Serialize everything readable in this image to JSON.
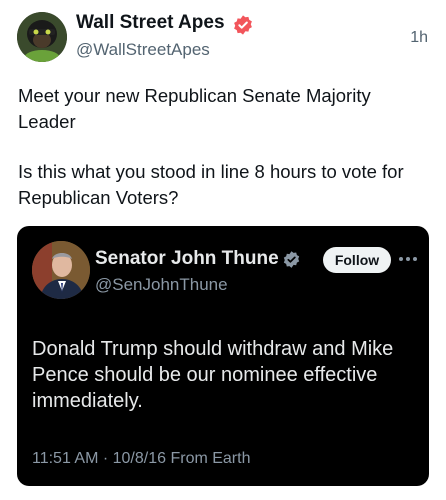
{
  "author": {
    "name": "Wall Street Apes",
    "handle": "@WallStreetApes",
    "verified": true,
    "avatar_icon": "gorilla-avatar"
  },
  "timestamp": "1h",
  "post": {
    "line1": "Meet your new Republican Senate Majority Leader",
    "line2": "Is this what you stood in line 8 hours to vote for Republican Voters?"
  },
  "quoted": {
    "name": "Senator John Thune",
    "handle": "@SenJohnThune",
    "verified": true,
    "follow_label": "Follow",
    "text": "Donald Trump should withdraw and Mike Pence should be our nominee effective immediately.",
    "meta": "11:51 AM · 10/8/16 From Earth"
  },
  "colors": {
    "verified_badge": "#f2555b",
    "quoted_badge": "#8b98a5",
    "quoted_background": "#000000"
  }
}
